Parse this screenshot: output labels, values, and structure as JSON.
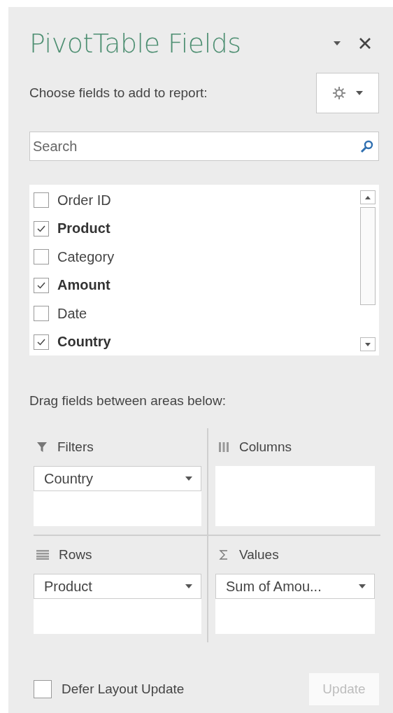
{
  "pane": {
    "title": "PivotTable Fields",
    "subtitle": "Choose fields to add to report:"
  },
  "search": {
    "placeholder": "Search"
  },
  "fields": [
    {
      "label": "Order ID",
      "checked": false
    },
    {
      "label": "Product",
      "checked": true
    },
    {
      "label": "Category",
      "checked": false
    },
    {
      "label": "Amount",
      "checked": true
    },
    {
      "label": "Date",
      "checked": false
    },
    {
      "label": "Country",
      "checked": true
    }
  ],
  "areas_hint": "Drag fields between areas below:",
  "areas": [
    {
      "kind": "filters",
      "title": "Filters",
      "items": [
        "Country"
      ]
    },
    {
      "kind": "columns",
      "title": "Columns"
    },
    {
      "kind": "rows",
      "title": "Rows",
      "items": [
        "Product"
      ]
    },
    {
      "kind": "values",
      "title": "Values",
      "items": [
        "Sum of Amou..."
      ]
    }
  ],
  "defer_layout_update": {
    "label": "Defer Layout Update",
    "checked": false
  },
  "update_button": {
    "label": "Update",
    "disabled": true
  }
}
